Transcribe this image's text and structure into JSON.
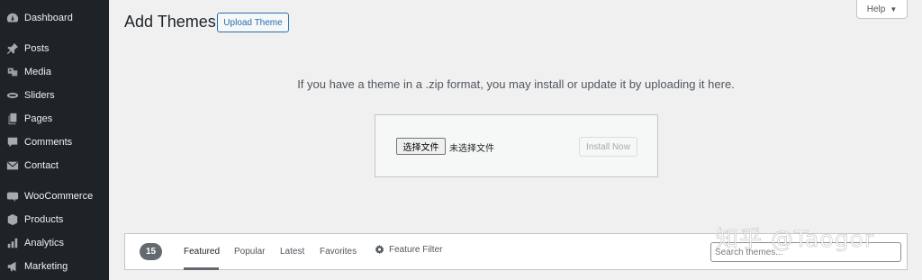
{
  "sidebar": {
    "items": [
      {
        "label": "Dashboard",
        "icon": "dashboard-icon"
      },
      {
        "label": "Posts",
        "icon": "pin-icon"
      },
      {
        "label": "Media",
        "icon": "media-icon"
      },
      {
        "label": "Sliders",
        "icon": "slider-icon"
      },
      {
        "label": "Pages",
        "icon": "pages-icon"
      },
      {
        "label": "Comments",
        "icon": "comment-icon"
      },
      {
        "label": "Contact",
        "icon": "envelope-icon"
      },
      {
        "label": "WooCommerce",
        "icon": "woo-icon"
      },
      {
        "label": "Products",
        "icon": "box-icon"
      },
      {
        "label": "Analytics",
        "icon": "bar-chart-icon"
      },
      {
        "label": "Marketing",
        "icon": "megaphone-icon"
      }
    ]
  },
  "header": {
    "title": "Add Themes",
    "upload_button": "Upload Theme",
    "help_label": "Help",
    "help_caret": "▼"
  },
  "upload": {
    "help_text": "If you have a theme in a .zip format, you may install or update it by uploading it here.",
    "choose_file_label": "选择文件",
    "no_file_text": "未选择文件",
    "install_button": "Install Now"
  },
  "filter_bar": {
    "count": "15",
    "links": [
      "Featured",
      "Popular",
      "Latest",
      "Favorites"
    ],
    "current": "Featured",
    "feature_filter": "Feature Filter",
    "search_placeholder": "Search themes..."
  },
  "watermark": "知乎 @Taogor",
  "colors": {
    "sidebar_bg": "#1d2327",
    "accent": "#2271b1",
    "page_bg": "#f0f0f1"
  }
}
